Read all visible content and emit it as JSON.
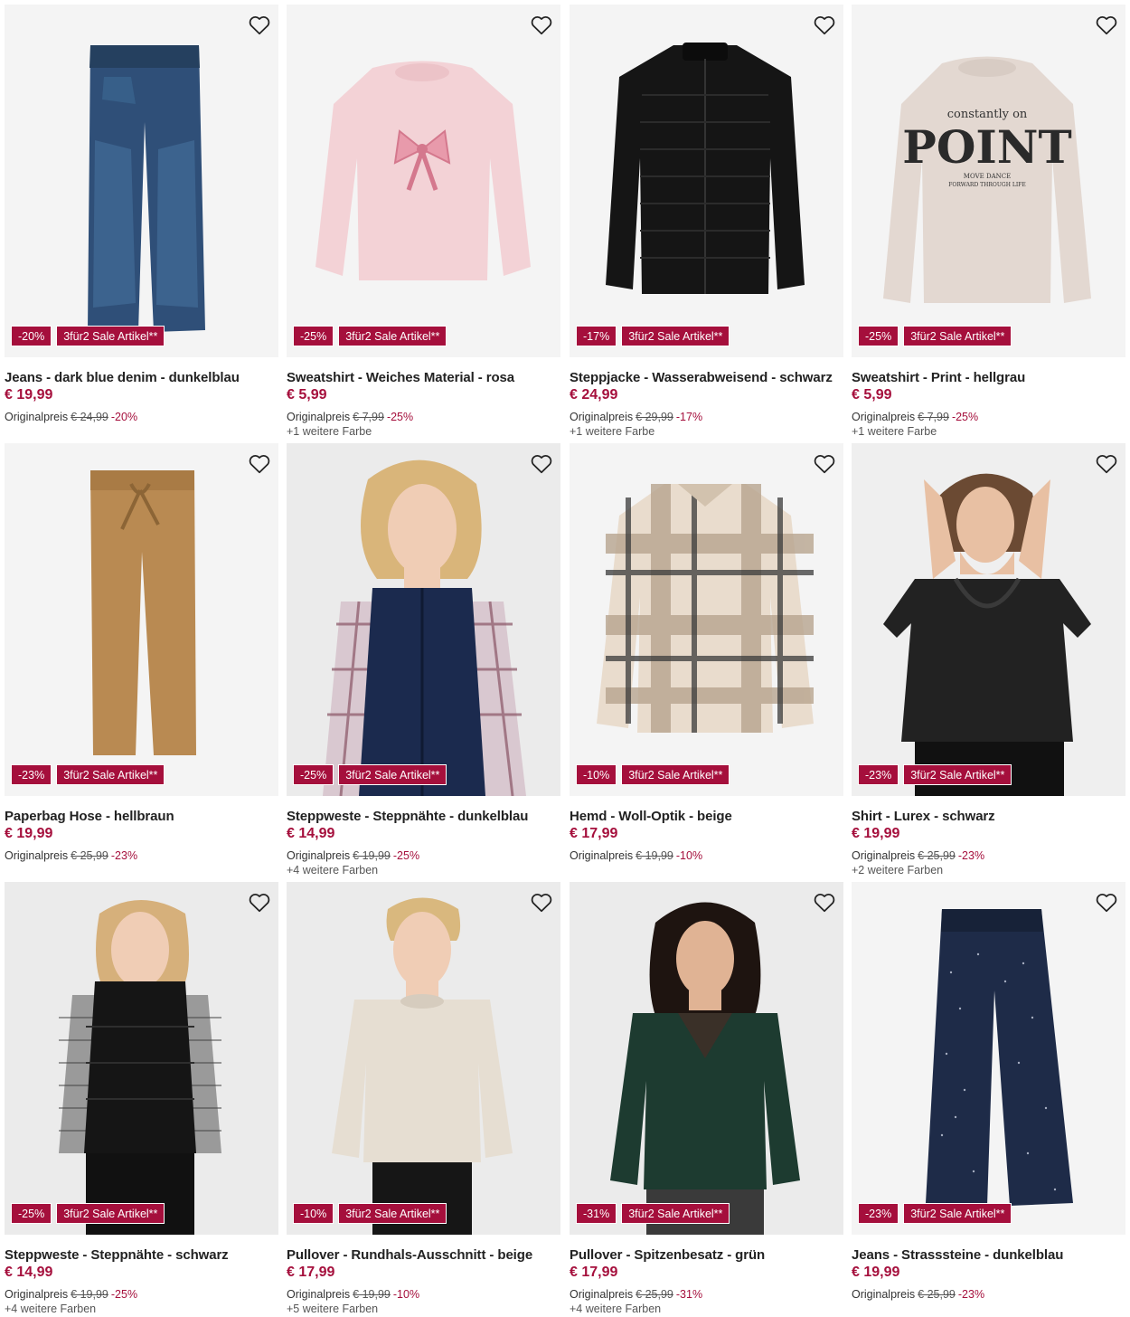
{
  "products": [
    {
      "title": "Jeans - dark blue denim - dunkelblau",
      "price": "€ 19,99",
      "orig_label": "Originalpreis",
      "orig_price": "€ 24,99",
      "discount": "-20%",
      "badge_discount": "-20%",
      "badge_sale": "3für2 Sale Artikel**",
      "more_colors": "",
      "image": "jeans-kids",
      "bg": "#f4f4f4"
    },
    {
      "title": "Sweatshirt - Weiches Material - rosa",
      "price": "€ 5,99",
      "orig_label": "Originalpreis",
      "orig_price": "€ 7,99",
      "discount": "-25%",
      "badge_discount": "-25%",
      "badge_sale": "3für2 Sale Artikel**",
      "more_colors": "+1 weitere Farbe",
      "image": "sweatshirt-bow",
      "bg": "#f4f4f4"
    },
    {
      "title": "Steppjacke - Wasserabweisend - schwarz",
      "price": "€ 24,99",
      "orig_label": "Originalpreis",
      "orig_price": "€ 29,99",
      "discount": "-17%",
      "badge_discount": "-17%",
      "badge_sale": "3für2 Sale Artikel**",
      "more_colors": "+1 weitere Farbe",
      "image": "puffer-jacket",
      "bg": "#f4f4f4"
    },
    {
      "title": "Sweatshirt - Print - hellgrau",
      "price": "€ 5,99",
      "orig_label": "Originalpreis",
      "orig_price": "€ 7,99",
      "discount": "-25%",
      "badge_discount": "-25%",
      "badge_sale": "3für2 Sale Artikel**",
      "more_colors": "+1 weitere Farbe",
      "image": "sweatshirt-point",
      "bg": "#f4f4f4"
    },
    {
      "title": "Paperbag Hose - hellbraun",
      "price": "€ 19,99",
      "orig_label": "Originalpreis",
      "orig_price": "€ 25,99",
      "discount": "-23%",
      "badge_discount": "-23%",
      "badge_sale": "3für2 Sale Artikel**",
      "more_colors": "",
      "image": "paperbag-pants",
      "bg": "#f4f4f4"
    },
    {
      "title": "Steppweste - Steppnähte - dunkelblau",
      "price": "€ 14,99",
      "orig_label": "Originalpreis",
      "orig_price": "€ 19,99",
      "discount": "-25%",
      "badge_discount": "-25%",
      "badge_sale": "3für2 Sale Artikel**",
      "more_colors": "+4 weitere Farben",
      "image": "vest-navy-model",
      "bg": "#eeeeee"
    },
    {
      "title": "Hemd - Woll-Optik - beige",
      "price": "€ 17,99",
      "orig_label": "Originalpreis",
      "orig_price": "€ 19,99",
      "discount": "-10%",
      "badge_discount": "-10%",
      "badge_sale": "3für2 Sale Artikel**",
      "more_colors": "",
      "image": "plaid-shirt",
      "bg": "#f4f4f4"
    },
    {
      "title": "Shirt - Lurex - schwarz",
      "price": "€ 19,99",
      "orig_label": "Originalpreis",
      "orig_price": "€ 25,99",
      "discount": "-23%",
      "badge_discount": "-23%",
      "badge_sale": "3für2 Sale Artikel**",
      "more_colors": "+2 weitere Farben",
      "image": "lurex-shirt-model",
      "bg": "#f1f1f1"
    },
    {
      "title": "Steppweste - Steppnähte - schwarz",
      "price": "€ 14,99",
      "orig_label": "Originalpreis",
      "orig_price": "€ 19,99",
      "discount": "-25%",
      "badge_discount": "-25%",
      "badge_sale": "3für2 Sale Artikel**",
      "more_colors": "+4 weitere Farben",
      "image": "vest-black-model",
      "bg": "#eeeeee"
    },
    {
      "title": "Pullover - Rundhals-Ausschnitt - beige",
      "price": "€ 17,99",
      "orig_label": "Originalpreis",
      "orig_price": "€ 19,99",
      "discount": "-10%",
      "badge_discount": "-10%",
      "badge_sale": "3für2 Sale Artikel**",
      "more_colors": "+5 weitere Farben",
      "image": "pullover-beige-model",
      "bg": "#eeeeee"
    },
    {
      "title": "Pullover - Spitzenbesatz - grün",
      "price": "€ 17,99",
      "orig_label": "Originalpreis",
      "orig_price": "€ 25,99",
      "discount": "-31%",
      "badge_discount": "-31%",
      "badge_sale": "3für2 Sale Artikel**",
      "more_colors": "+4 weitere Farben",
      "image": "pullover-green-model",
      "bg": "#eeeeee"
    },
    {
      "title": "Jeans - Strasssteine - dunkelblau",
      "price": "€ 19,99",
      "orig_label": "Originalpreis",
      "orig_price": "€ 25,99",
      "discount": "-23%",
      "badge_discount": "-23%",
      "badge_sale": "3für2 Sale Artikel**",
      "more_colors": "",
      "image": "jeans-rhinestone",
      "bg": "#f4f4f4"
    }
  ],
  "sweatshirt_print": {
    "line1": "constantly on",
    "line2": "POINT",
    "line3": "MOVE DANCE",
    "line4": "FORWARD THROUGH LIFE"
  },
  "colors": {
    "accent": "#a50f3c",
    "text": "#222222",
    "muted": "#555555"
  }
}
